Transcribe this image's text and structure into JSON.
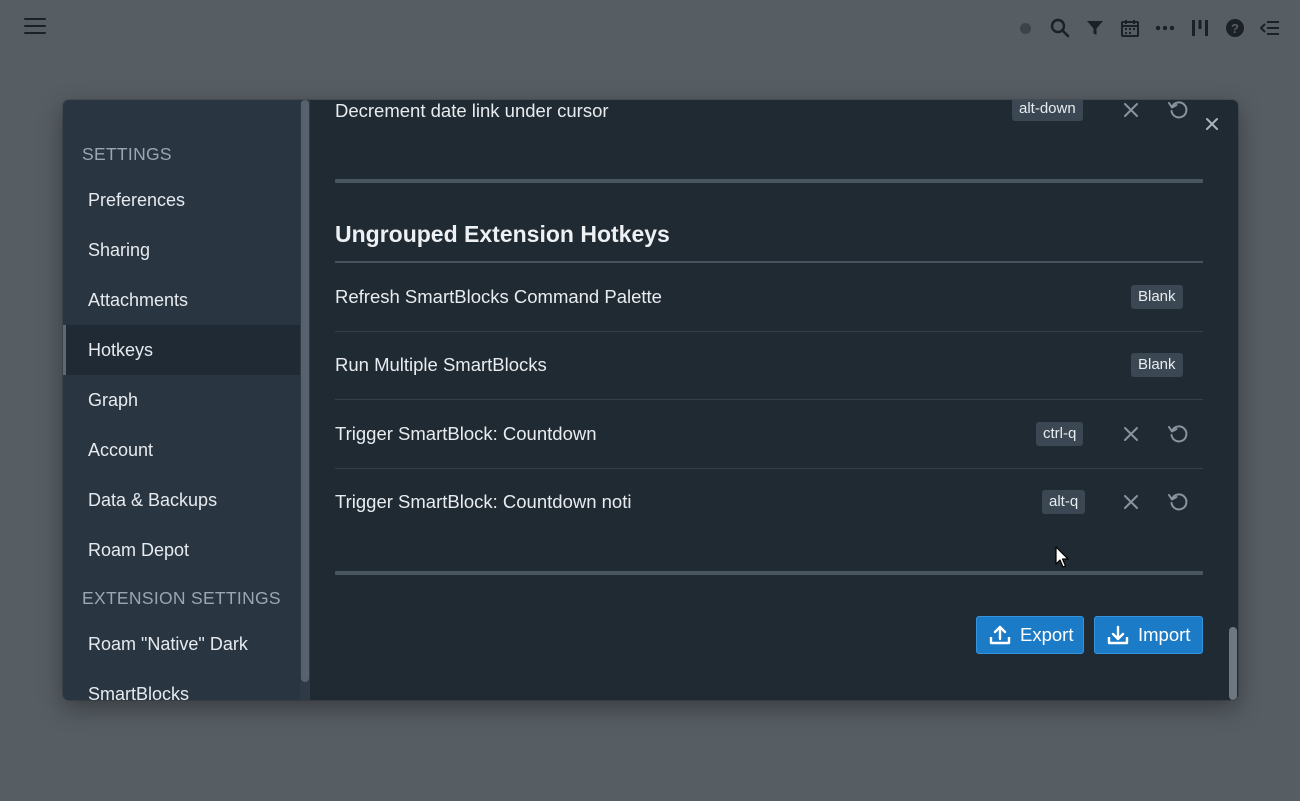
{
  "settings_heading": "SETTINGS",
  "extension_settings_heading": "EXTENSION SETTINGS",
  "sidebar_items": [
    {
      "label": "Preferences"
    },
    {
      "label": "Sharing"
    },
    {
      "label": "Attachments"
    },
    {
      "label": "Hotkeys",
      "active": true
    },
    {
      "label": "Graph"
    },
    {
      "label": "Account"
    },
    {
      "label": "Data & Backups"
    },
    {
      "label": "Roam Depot"
    }
  ],
  "extension_items": [
    {
      "label": "Roam \"Native\" Dark"
    },
    {
      "label": "SmartBlocks"
    }
  ],
  "top_row": {
    "label": "Decrement date link under cursor",
    "hotkey": "alt-down"
  },
  "section": {
    "title": "Ungrouped Extension Hotkeys"
  },
  "rows": [
    {
      "label": "Refresh SmartBlocks Command Palette",
      "hotkey": "Blank"
    },
    {
      "label": "Run Multiple SmartBlocks",
      "hotkey": "Blank"
    },
    {
      "label": "Trigger SmartBlock: Countdown",
      "hotkey": "ctrl-q"
    },
    {
      "label": "Trigger SmartBlock: Countdown noti",
      "hotkey": "alt-q"
    }
  ],
  "buttons": {
    "export": "Export",
    "import": "Import"
  },
  "topbar_icons": [
    "status-dot",
    "search-icon",
    "filter-icon",
    "calendar-icon",
    "more-icon",
    "columns-icon",
    "help-icon",
    "sidebar-toggle-icon"
  ],
  "colors": {
    "accent": "#1b7bc6",
    "dialog_bg": "#202a33",
    "sidebar_bg": "#293642",
    "overlay_bg": "#565d63"
  }
}
